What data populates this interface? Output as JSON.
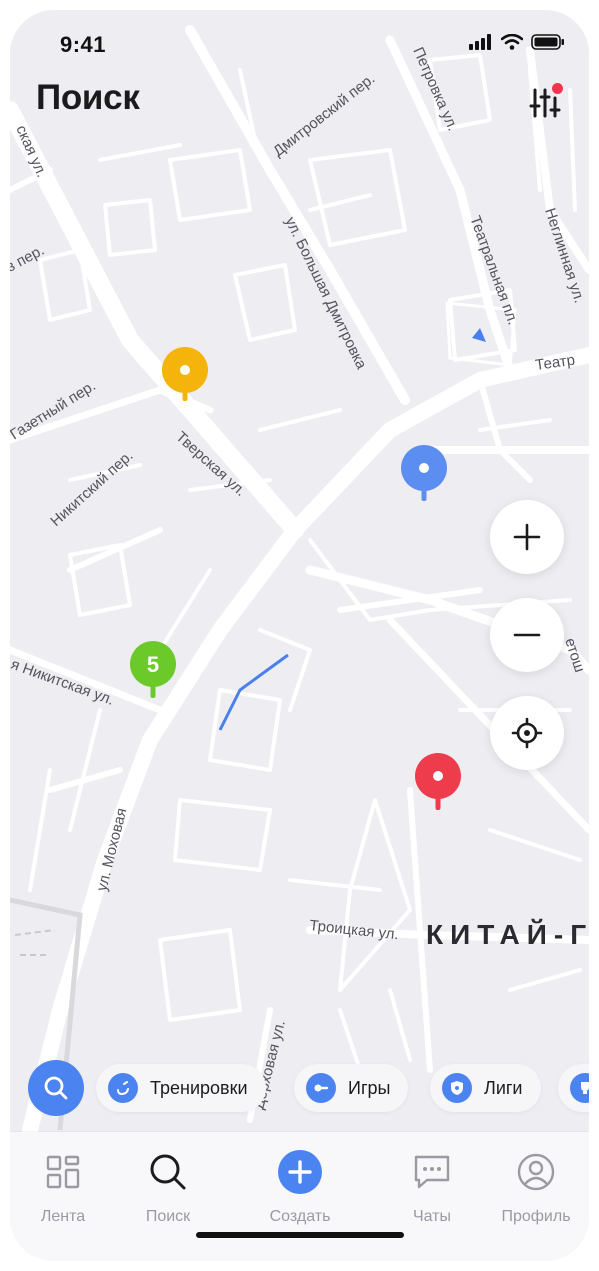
{
  "status_bar": {
    "time": "9:41"
  },
  "header": {
    "title": "Поиск",
    "filter_icon": "sliders-icon",
    "filter_badge_color": "#f0374f"
  },
  "map": {
    "streets": {
      "tverskaya": "Тверская ул.",
      "dmitrovsky": "Дмитровский пер.",
      "petrovka": "Петровка ул.",
      "neglinnaya": "Неглинная ул.",
      "teatralny": "Театральная пл.",
      "teatr_right": "Театр",
      "bolshaya_dmitrovka": "ул. Большая Дмитровка",
      "gazetny": "Газетный пер.",
      "nikitsky": "Никитский пер.",
      "tverskaya_left": "ская ул.",
      "per_left": "з пер.",
      "nikitskaya": "я Никитская ул.",
      "mokhovaya": "ул. Моховая",
      "troitskaya": "Троицкая ул.",
      "right_cut": "етош",
      "vozdvizhenka": "Дорховая ул."
    },
    "district": "КИТАЙ-Г",
    "markers": [
      {
        "name": "yellow-marker",
        "color": "#f5b40c",
        "label": ""
      },
      {
        "name": "blue-marker",
        "color": "#5b8ef0",
        "label": ""
      },
      {
        "name": "green-cluster-marker",
        "color": "#6cc92a",
        "label": "5"
      },
      {
        "name": "red-marker",
        "color": "#ef3c4d",
        "label": ""
      }
    ]
  },
  "map_controls": {
    "zoom_in_icon": "plus-icon",
    "zoom_out_icon": "minus-icon",
    "locate_icon": "crosshair-icon"
  },
  "categories": {
    "search_icon": "search-icon",
    "items": [
      {
        "label": "Тренировки",
        "icon": "whistle-icon"
      },
      {
        "label": "Игры",
        "icon": "controller-icon"
      },
      {
        "label": "Лиги",
        "icon": "shield-icon"
      },
      {
        "label": "",
        "icon": "trophy-icon"
      }
    ]
  },
  "tabbar": {
    "active_color": "#1c1c1f",
    "accent": "#4b84f1",
    "items": [
      {
        "label": "Лента",
        "icon": "grid-icon"
      },
      {
        "label": "Поиск",
        "icon": "search-icon"
      },
      {
        "label": "Создать",
        "icon": "plus-circle-icon"
      },
      {
        "label": "Чаты",
        "icon": "chat-icon"
      },
      {
        "label": "Профиль",
        "icon": "profile-icon"
      }
    ]
  }
}
